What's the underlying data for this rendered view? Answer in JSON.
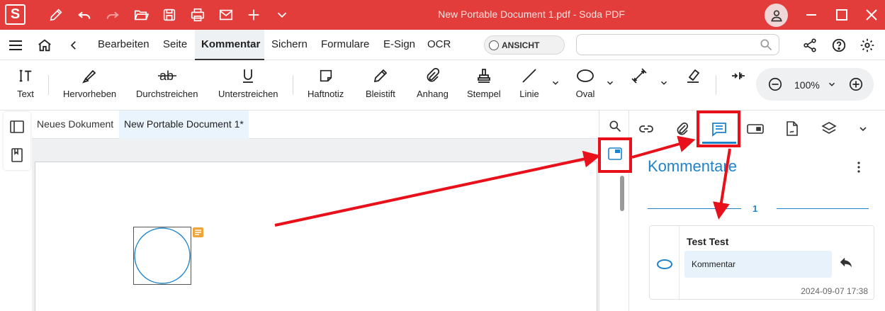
{
  "titlebar": {
    "logo_letter": "S",
    "document_title": "New Portable Document 1.pdf   -   Soda PDF",
    "quick_actions": [
      "pen-icon",
      "undo-icon",
      "redo-icon",
      "open-folder-icon",
      "save-icon",
      "print-icon",
      "mail-icon",
      "plus-icon",
      "chevron-down-icon"
    ],
    "window_controls": [
      "minimize-icon",
      "maximize-icon",
      "close-icon"
    ]
  },
  "menu": {
    "tabs": [
      "Bearbeiten",
      "Seite",
      "Kommentar",
      "Sichern",
      "Formulare",
      "E-Sign",
      "OCR"
    ],
    "active_tab": "Kommentar",
    "view_toggle_label": "ANSICHT",
    "search_placeholder": "",
    "right_icons": [
      "share-icon",
      "help-icon",
      "settings-icon"
    ]
  },
  "toolbar": {
    "text": "Text",
    "highlight": "Hervorheben",
    "strikethrough": "Durchstreichen",
    "underline": "Unterstreichen",
    "sticky_note": "Haftnotiz",
    "pencil": "Bleistift",
    "attachment": "Anhang",
    "stamp": "Stempel",
    "line": "Linie",
    "oval": "Oval",
    "zoom_value": "100%"
  },
  "document_tabs": {
    "tab1": "Neues Dokument",
    "tab2": "New Portable Document 1*"
  },
  "right_panel": {
    "title": "Kommentare",
    "page_number": "1",
    "comment": {
      "author": "Test Test",
      "text": "Kommentar",
      "date": "2024-09-07 17:38"
    }
  },
  "colors": {
    "titlebar_bg": "#e23d3b",
    "accent_blue": "#1f83c9",
    "annotation_red": "#e8101a",
    "note_orange": "#f0a53a"
  }
}
